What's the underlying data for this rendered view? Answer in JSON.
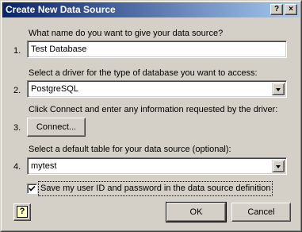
{
  "window": {
    "title": "Create New Data Source",
    "help_caption": "?",
    "close_caption": "×"
  },
  "steps": {
    "name": {
      "number": "1.",
      "label": "What name do you want to give your data source?",
      "value": "Test Database"
    },
    "driver": {
      "number": "2.",
      "label": "Select a driver for the type of database you want to access:",
      "value": "PostgreSQL"
    },
    "connect": {
      "number": "3.",
      "label": "Click Connect and enter any information requested by the driver:",
      "button_label": "Connect..."
    },
    "table": {
      "number": "4.",
      "label": "Select a default table for your data source (optional):",
      "value": "mytest"
    }
  },
  "save_credentials": {
    "checked": true,
    "label": "Save my user ID and password in the data source definition"
  },
  "footer": {
    "help_icon_glyph": "?",
    "ok_label": "OK",
    "cancel_label": "Cancel"
  },
  "colors": {
    "titlebar_start": "#0a246a",
    "titlebar_end": "#a6caf0",
    "dialog_face": "#d4d0c8"
  }
}
